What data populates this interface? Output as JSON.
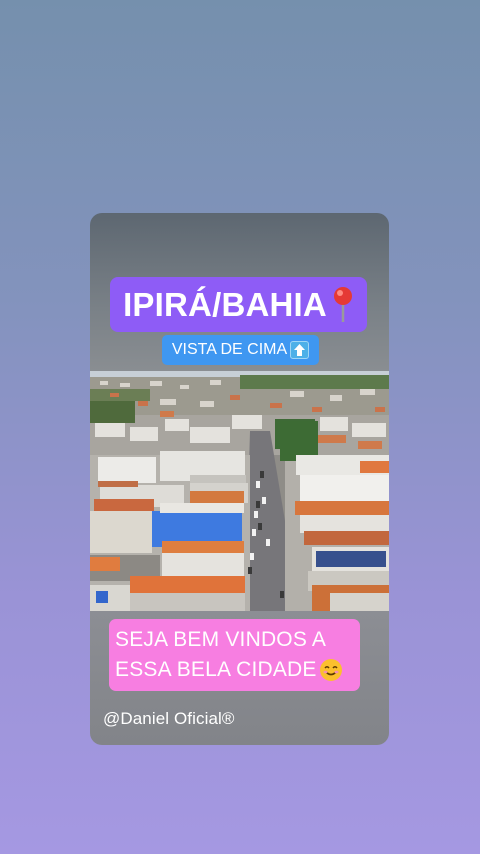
{
  "story": {
    "title": "IPIRÁ/BAHIA",
    "title_icon": "round-pushpin-icon",
    "subtitle": "VISTA DE CIMA",
    "subtitle_icon": "up-arrow-box-icon",
    "welcome_line1": "SEJA BEM VINDOS A",
    "welcome_line2": "ESSA BELA CIDADE",
    "welcome_icon": "smiling-face-icon",
    "handle": "@Daniel Oficial®"
  },
  "colors": {
    "background_top": "#7590ad",
    "background_bottom": "#a598e2",
    "title_pill": "#8e5cf6",
    "subtitle_pill": "#3f97f1",
    "welcome_pill": "#f77ee1"
  }
}
